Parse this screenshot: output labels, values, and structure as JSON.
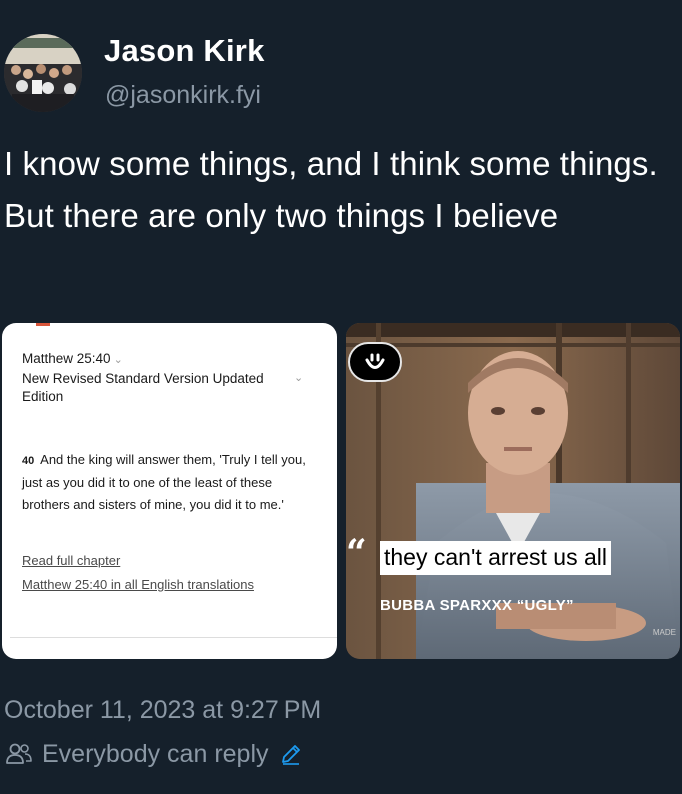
{
  "author": {
    "display_name": "Jason Kirk",
    "handle": "@jasonkirk.fyi"
  },
  "post": {
    "text": "I know some things, and I think some things. But there are only two things I believe"
  },
  "media": {
    "left": {
      "reference": "Matthew 25:40",
      "version": "New Revised Standard Version Updated Edition",
      "verse_number": "40",
      "verse_text": "And the king will answer them, 'Truly I tell you, just as you did it to one of the least of these brothers and sisters of mine, you did it to me.'",
      "link_read": "Read full chapter",
      "link_translations": "Matthew 25:40 in all English translations"
    },
    "right": {
      "quote_mark": "“",
      "caption": "they can't arrest us all",
      "attribution": "BUBBA SPARXXX “UGLY”",
      "watermark": "MADE"
    }
  },
  "meta": {
    "timestamp": "October 11, 2023 at 9:27 PM",
    "reply_setting": "Everybody can reply"
  },
  "colors": {
    "background": "#15202b",
    "secondary_text": "#8b98a5",
    "accent": "#1d9bf0"
  }
}
